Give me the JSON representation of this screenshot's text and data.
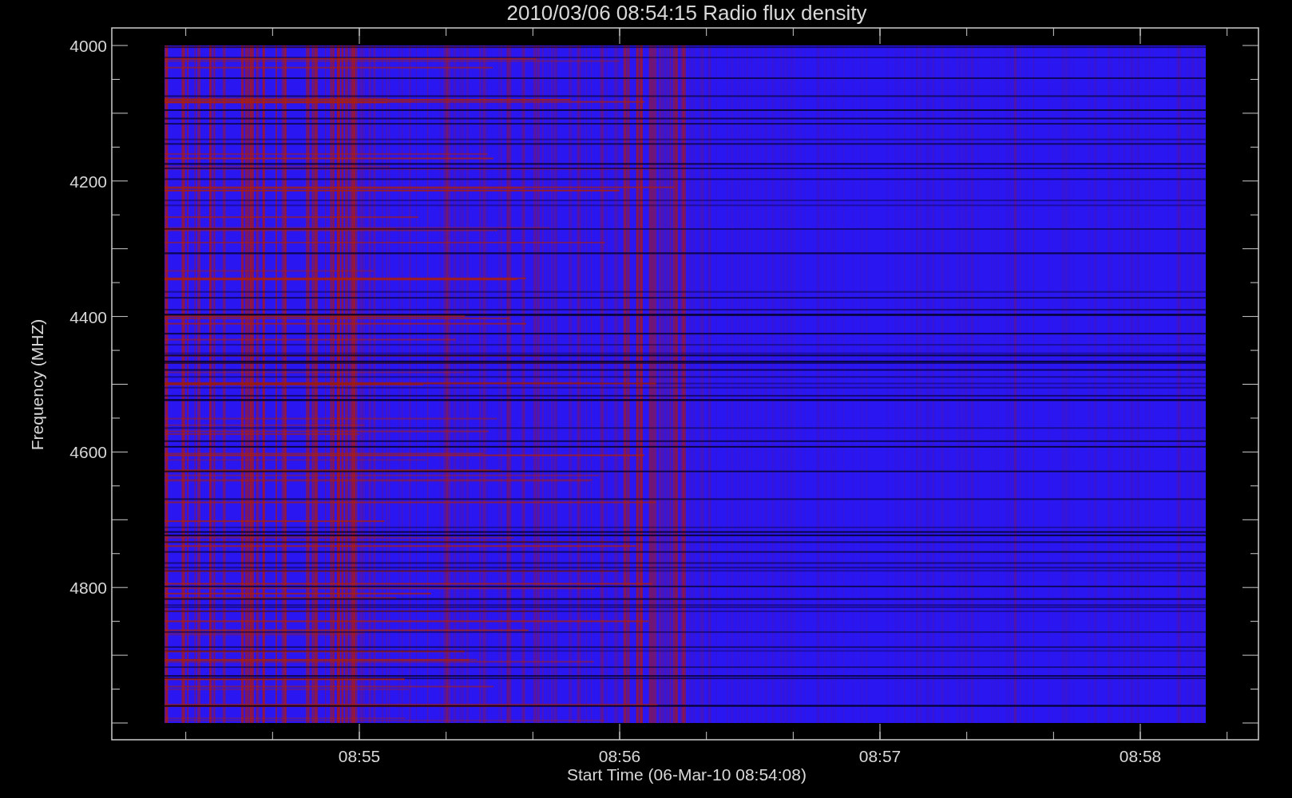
{
  "plot": {
    "title": "2010/03/06 08:54:15 Radio flux density",
    "xlabel": "Start Time (06-Mar-10 08:54:08)",
    "ylabel": "Frequency (MHZ)",
    "xticks": [
      "08:55",
      "08:56",
      "08:57",
      "08:58"
    ],
    "yticks": [
      "4000",
      "4200",
      "4400",
      "4600",
      "4800"
    ]
  }
}
